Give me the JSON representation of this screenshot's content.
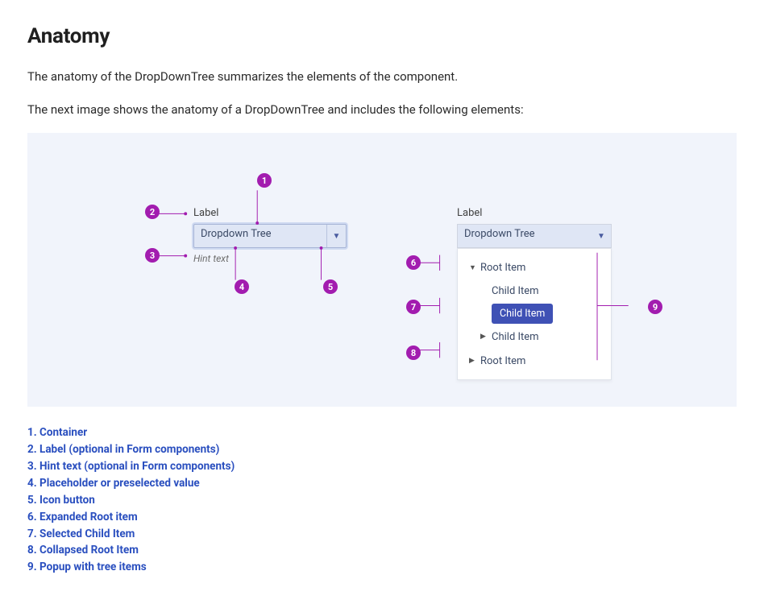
{
  "title": "Anatomy",
  "intro1": "The anatomy of the DropDownTree summarizes the elements of the component.",
  "intro2": "The next image shows the anatomy of a DropDownTree and includes the following elements:",
  "left": {
    "label": "Label",
    "value": "Dropdown Tree",
    "hint": "Hint text"
  },
  "right": {
    "label": "Label",
    "value": "Dropdown Tree",
    "items": {
      "root1": "Root Item",
      "child1": "Child Item",
      "child2_selected": "Child Item",
      "child3": "Child Item",
      "root2": "Root Item"
    }
  },
  "callouts": {
    "c1": "1",
    "c2": "2",
    "c3": "3",
    "c4": "4",
    "c5": "5",
    "c6": "6",
    "c7": "7",
    "c8": "8",
    "c9": "9"
  },
  "legend": [
    "1. Container",
    "2. Label (optional in Form components)",
    "3. Hint text (optional in Form components)",
    "4. Placeholder or preselected value",
    "5. Icon button",
    "6. Expanded Root item",
    "7. Selected Child Item",
    "8. Collapsed Root Item",
    "9. Popup with tree items"
  ],
  "colors": {
    "accent": "#a21caf",
    "link": "#2a4fbf",
    "selected_bg": "#3f51b5",
    "panel_bg": "#f1f4fb",
    "field_bg": "#dfe6f5"
  }
}
